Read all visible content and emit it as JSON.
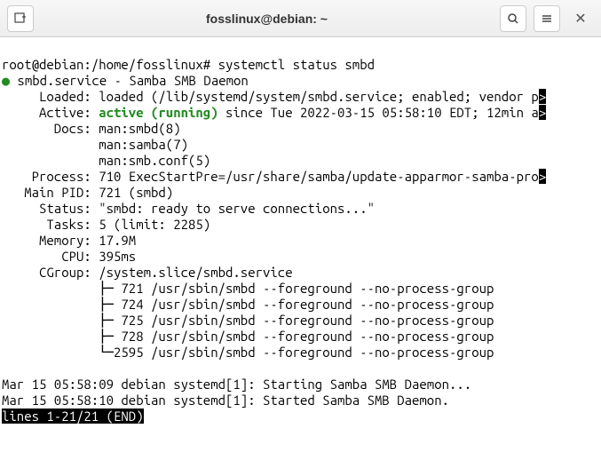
{
  "titlebar": {
    "title": "fosslinux@debian: ~"
  },
  "term": {
    "prompt": "root@debian:/home/fosslinux# ",
    "cmd": "systemctl status smbd",
    "dot": "●",
    "service_line": " smbd.service - Samba SMB Daemon",
    "loaded": "     Loaded: loaded (/lib/systemd/system/smbd.service; enabled; vendor p",
    "active_label": "     Active: ",
    "active_state": "active (running)",
    "active_rest": " since Tue 2022-03-15 05:58:10 EDT; 12min a",
    "docs": "       Docs: man:smbd(8)",
    "docs2": "             man:samba(7)",
    "docs3": "             man:smb.conf(5)",
    "process": "    Process: 710 ExecStartPre=/usr/share/samba/update-apparmor-samba-pro",
    "mainpid": "   Main PID: 721 (smbd)",
    "status": "     Status: \"smbd: ready to serve connections...\"",
    "tasks": "      Tasks: 5 (limit: 2285)",
    "memory": "     Memory: 17.9M",
    "cpu": "        CPU: 395ms",
    "cgroup": "     CGroup: /system.slice/smbd.service",
    "cg1": "             ├─ 721 /usr/sbin/smbd --foreground --no-process-group",
    "cg2": "             ├─ 724 /usr/sbin/smbd --foreground --no-process-group",
    "cg3": "             ├─ 725 /usr/sbin/smbd --foreground --no-process-group",
    "cg4": "             ├─ 728 /usr/sbin/smbd --foreground --no-process-group",
    "cg5": "             └─2595 /usr/sbin/smbd --foreground --no-process-group",
    "blank": "",
    "log1": "Mar 15 05:58:09 debian systemd[1]: Starting Samba SMB Daemon...",
    "log2": "Mar 15 05:58:10 debian systemd[1]: Started Samba SMB Daemon.",
    "pager": "lines 1-21/21 (END)",
    "marker": ">"
  }
}
